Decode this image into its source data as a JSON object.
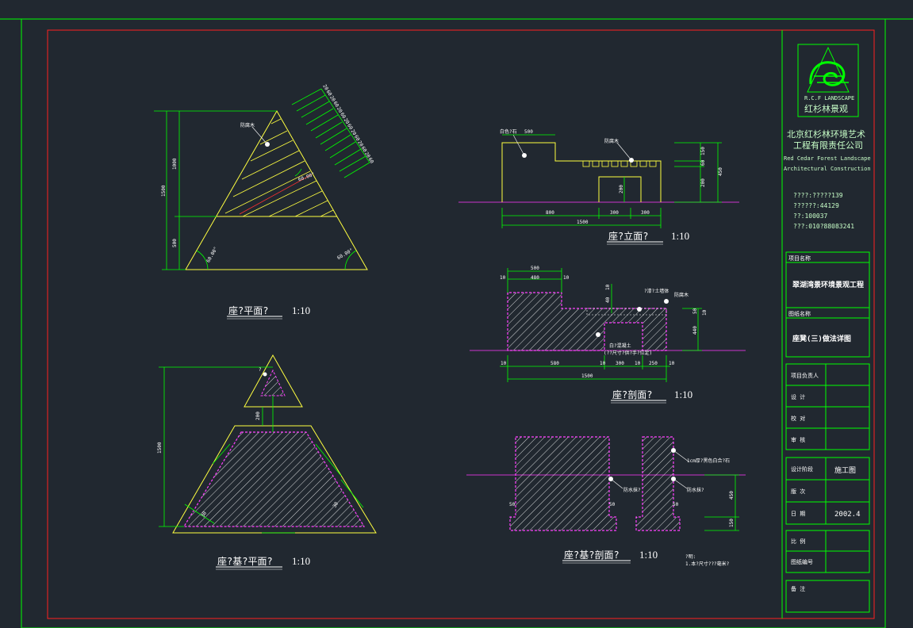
{
  "colors": {
    "background": "#212830",
    "border_green": "#00ff00",
    "border_red": "#ff2020",
    "outline_yellow": "#ffff40",
    "dimension_green": "#00ff00",
    "hatch_magenta": "#ff40ff",
    "hatch_white": "#ffffff",
    "ground_magenta": "#cc33cc"
  },
  "drawings": {
    "plan": {
      "title": "座?平面?",
      "scale": "1:10",
      "dims": {
        "h_total": "1500",
        "h_top": "1000",
        "h_bottom": "500",
        "angle_left": "60.00°",
        "angle_right": "60.00°",
        "angle_inner": "60.00°",
        "strip": [
          "20",
          "60",
          "20",
          "60",
          "20",
          "60",
          "20",
          "60",
          "20",
          "60",
          "20",
          "60",
          "20",
          "60"
        ]
      },
      "label": "防腐木"
    },
    "elevation": {
      "title": "座?立面?",
      "scale": "1:10",
      "dims": {
        "top": "500",
        "b1": "800",
        "b2": "300",
        "b3": "300",
        "total": "1500",
        "r1": "150",
        "r2": "60",
        "r3": "200",
        "r_total": "450",
        "opening": "200"
      },
      "labels": [
        "白色?石",
        "防腐木"
      ]
    },
    "section": {
      "title": "座?剖面?",
      "scale": "1:10",
      "dims": {
        "top_total": "500",
        "top_inner": "480",
        "t10a": "10",
        "t10b": "10",
        "b10a": "10",
        "b580": "580",
        "b10b": "10",
        "b300": "300",
        "b10c": "10",
        "b250": "250",
        "b10d": "10",
        "total": "1500",
        "v10": "10",
        "v40": "40",
        "v50": "50",
        "v440": "440",
        "v10r": "10"
      },
      "labels": [
        "?漆?土墙体",
        "防腐木",
        "白?混凝土",
        "(??尺寸?供?手?位定)"
      ]
    },
    "base_plan": {
      "title": "座?基?平面?",
      "scale": "1:10",
      "dims": {
        "h": "1500",
        "v200": "200",
        "v30a": "30",
        "v30b": "30"
      },
      "label": "?"
    },
    "base_section": {
      "title": "座?基?剖面?",
      "scale": "1:10",
      "dims": {
        "v450": "450",
        "v150": "150",
        "d50a": "50",
        "d50b": "50",
        "d50c": "50"
      },
      "labels": [
        "1cm厚?黑色白合?石",
        "防水抹?",
        "防水抹?"
      ],
      "note": [
        "?明:",
        "1.本?尺寸???毫米?"
      ]
    }
  },
  "title_block": {
    "logo_text": "R.C.F LANDSCAPE",
    "logo_cn": "红杉林景观",
    "company_cn": [
      "北京红杉林环境艺术",
      "工程有限责任公司"
    ],
    "company_en": [
      "Red Cedar Forest Landscape",
      "Architectural Construction"
    ],
    "contact": [
      "????:?????139",
      "??????:44129",
      "??:100037",
      "???:010?88083241"
    ],
    "project_label": "项目名称",
    "project_name": "翠湖湾景环境景观工程",
    "drawing_label": "图纸名称",
    "drawing_name": "座凳(三)做法详图",
    "rows": [
      {
        "label": "项目负责人",
        "value": ""
      },
      {
        "label": "设      计",
        "value": ""
      },
      {
        "label": "校      对",
        "value": ""
      },
      {
        "label": "审      核",
        "value": ""
      }
    ],
    "rows2": [
      {
        "label": "设计阶段",
        "value": "施工图"
      },
      {
        "label": "版      次",
        "value": ""
      },
      {
        "label": "日      期",
        "value": "2002.4"
      }
    ],
    "rows3": [
      {
        "label": "比      例",
        "value": ""
      },
      {
        "label": "图纸编号",
        "value": ""
      }
    ],
    "remarks_label": "备      注"
  }
}
